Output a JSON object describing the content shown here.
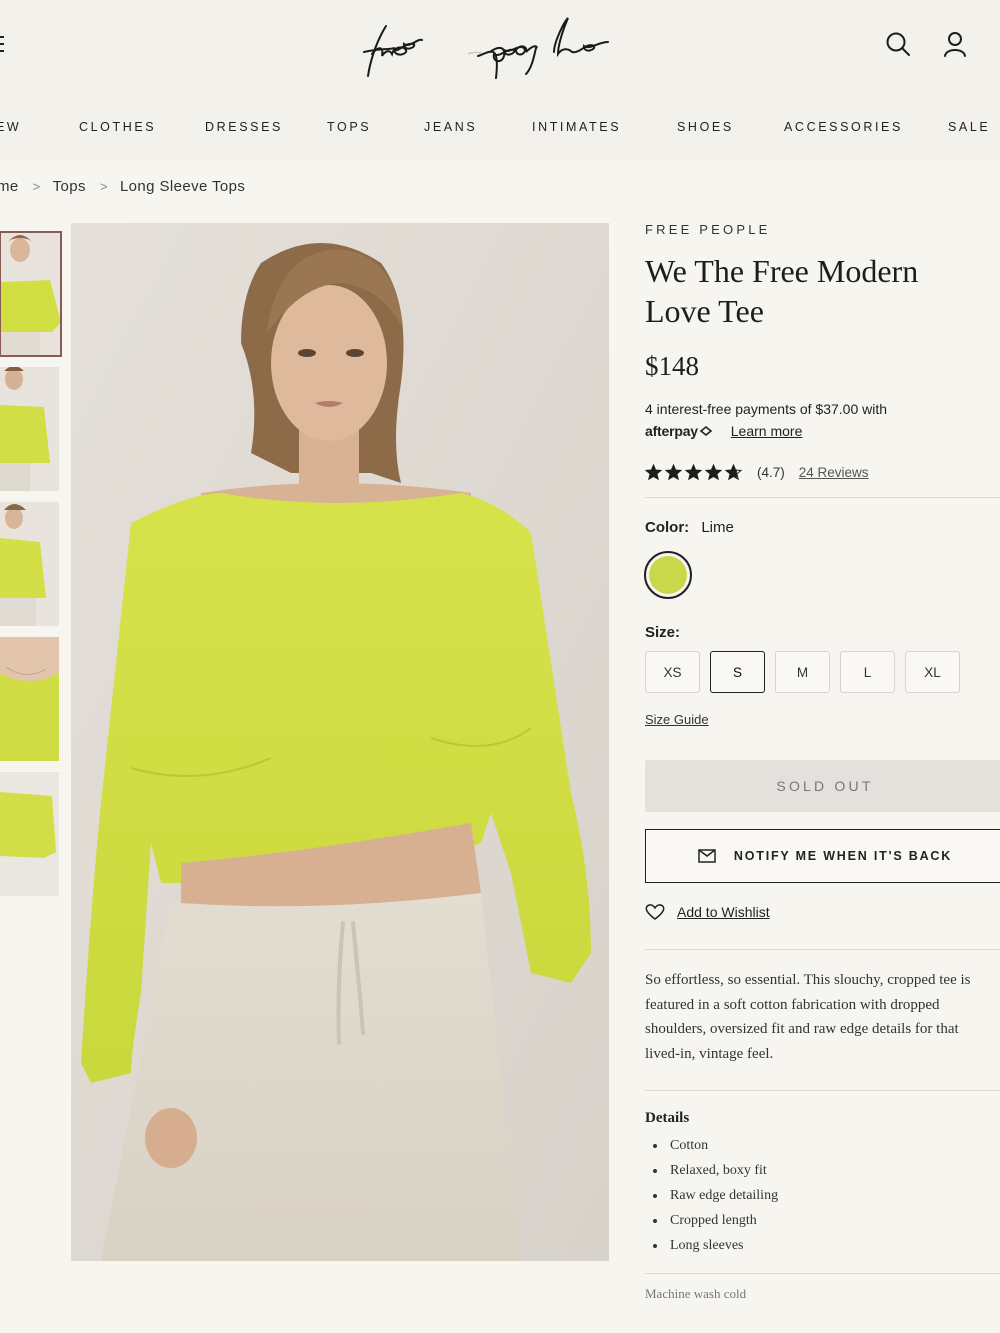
{
  "header": {
    "logo_text": "free people",
    "nav": [
      "EW",
      "CLOTHES",
      "DRESSES",
      "TOPS",
      "JEANS",
      "INTIMATES",
      "SHOES",
      "ACCESSORIES",
      "SALE"
    ]
  },
  "breadcrumb": [
    "me",
    "Tops",
    "Long Sleeve Tops"
  ],
  "product": {
    "brand": "FREE PEOPLE",
    "title_line1": "We The Free Modern",
    "title_line2": "Love Tee",
    "price": "$148",
    "afterpay_text": "4 interest-free payments of $37.00 with",
    "afterpay_logo": "afterpay",
    "learn_more": "Learn more",
    "rating": 4.7,
    "rating_text": "(4.7)",
    "reviews": "24 Reviews",
    "color_label": "Color:",
    "color_value": "Lime",
    "swatch_color": "#c8d84a",
    "size_label": "Size:",
    "sizes": [
      "XS",
      "S",
      "M",
      "L",
      "XL"
    ],
    "selected_size": "S",
    "size_guide": "Size Guide",
    "sold_out": "SOLD OUT",
    "notify": "NOTIFY ME WHEN IT'S BACK",
    "wishlist": "Add to Wishlist",
    "description": "So effortless, so essential. This slouchy, cropped tee is featured in a soft cotton fabrication with dropped shoulders, oversized fit and raw edge details for that lived-in, vintage feel.",
    "details_title": "Details",
    "details": [
      "Cotton",
      "Relaxed, boxy fit",
      "Raw edge detailing",
      "Cropped length",
      "Long sleeves"
    ],
    "care": "Machine wash cold"
  },
  "colors": {
    "background": "#f7f5f0",
    "header_bg": "#f3f1ec",
    "garment": "#d4e045",
    "active_thumb_border": "#8a5b54"
  }
}
